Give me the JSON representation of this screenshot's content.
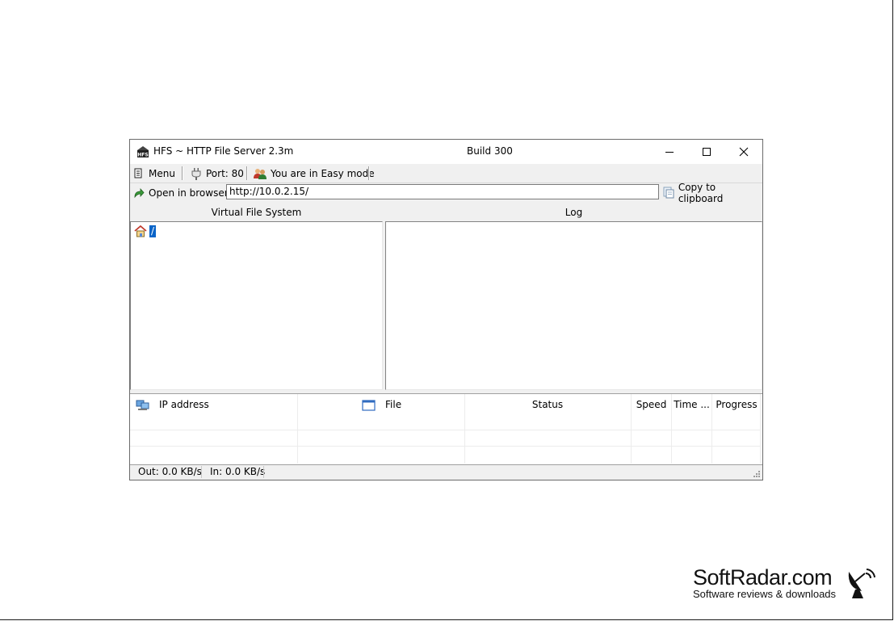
{
  "window": {
    "title": "HFS ~ HTTP File Server 2.3m",
    "build": "Build 300"
  },
  "toolbar": {
    "menu_label": "Menu",
    "port_label": "Port: 80",
    "mode_label": "You are in Easy mode"
  },
  "address_bar": {
    "open_browser_label": "Open in browser",
    "url": "http://10.0.2.15/",
    "copy_label": "Copy to clipboard"
  },
  "vfs": {
    "header": "Virtual File System",
    "root_label": "/"
  },
  "log": {
    "header": "Log"
  },
  "connections": {
    "columns": [
      "IP address",
      "File",
      "Status",
      "Speed",
      "Time ...",
      "Progress"
    ]
  },
  "statusbar": {
    "out": "Out: 0.0 KB/s",
    "in": "In: 0.0 KB/s"
  },
  "watermark": {
    "brand": "SoftRadar.com",
    "tagline": "Software reviews & downloads"
  },
  "icons": {
    "app": "hfs-logo-icon",
    "menu": "menu-icon",
    "port": "plug-icon",
    "mode": "users-icon",
    "browser": "open-browser-icon",
    "clipboard": "clipboard-icon",
    "home": "home-icon",
    "ip": "network-computers-icon",
    "file": "window-file-icon"
  }
}
